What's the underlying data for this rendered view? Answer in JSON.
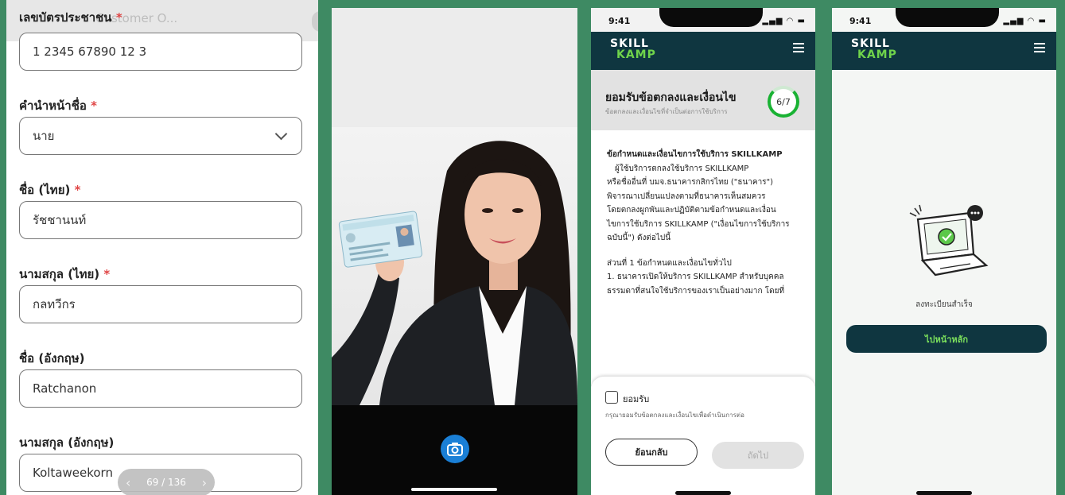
{
  "form": {
    "ghost_text": "Customer O...",
    "fields": [
      {
        "label": "เลขบัตรประชาชน",
        "required": true,
        "value": "1 2345 67890 12 3"
      },
      {
        "label": "คำนำหน้าชื่อ",
        "required": true,
        "value": "นาย",
        "dropdown": true
      },
      {
        "label": "ชื่อ (ไทย)",
        "required": true,
        "value": "รัชชานนท์"
      },
      {
        "label": "นามสกุล (ไทย)",
        "required": true,
        "value": "กลทวีกร"
      },
      {
        "label": "ชื่อ (อังกฤษ)",
        "required": false,
        "value": "Ratchanon"
      },
      {
        "label": "นามสกุล (อังกฤษ)",
        "required": false,
        "value": "Koltaweekorn"
      }
    ],
    "required_mark": "*",
    "pager": {
      "prev": "‹",
      "text": "69 / 136",
      "next": "›"
    }
  },
  "camera": {
    "shutter_icon": "camera-icon"
  },
  "terms": {
    "time": "9:41",
    "status_icons": "▂▄▆ ◠ ▬",
    "logo_top": "SKILL",
    "logo_bottom": "KAMP",
    "title": "ยอมรับข้อตกลงและเงื่อนไข",
    "subtitle": "ข้อตกลงและเงื่อนไขที่จำเป็นต่อการใช้บริการ",
    "progress": "6/7",
    "body_heading": "ข้อกำหนดและเงื่อนไขการใช้บริการ SKILLKAMP",
    "body_lines": [
      "ผู้ใช้บริการตกลงใช้บริการ SKILLKAMP",
      "หรือชื่ออื่นที่ บมจ.ธนาคารกสิกรไทย (\"ธนาคาร\")",
      "พิจารณาเปลี่ยนแปลงตามที่ธนาคารเห็นสมควร",
      "โดยตกลงผูกพันและปฏิบัติตามข้อกำหนดและเงื่อน",
      "ไขการใช้บริการ SKILLKAMP (\"เงื่อนไขการใช้บริการ",
      "ฉบับนี้\") ดังต่อไปนี้"
    ],
    "section_title": "ส่วนที่ 1 ข้อกำหนดและเงื่อนไขทั่วไป",
    "section_lines": [
      "1. ธนาคารเปิดให้บริการ SKILLKAMP สำหรับบุคคล",
      "ธรรมดาที่สนใจใช้บริการของเราเป็นอย่างมาก โดยที่"
    ],
    "accept_label": "ยอมรับ",
    "accept_note": "กรุณายอมรับข้อตกลงและเงื่อนไขเพื่อดำเนินการต่อ",
    "back_button": "ย้อนกลับ",
    "next_button": "ถัดไป"
  },
  "success": {
    "time": "9:41",
    "status_icons": "▂▄▆ ◠ ▬",
    "logo_top": "SKILL",
    "logo_bottom": "KAMP",
    "message": "ลงทะเบียนสำเร็จ",
    "home_button": "ไปหน้าหลัก"
  },
  "colors": {
    "brand_dark": "#0f3640",
    "brand_green": "#6fd34b",
    "background": "#3e8a63",
    "required": "#e04545"
  }
}
